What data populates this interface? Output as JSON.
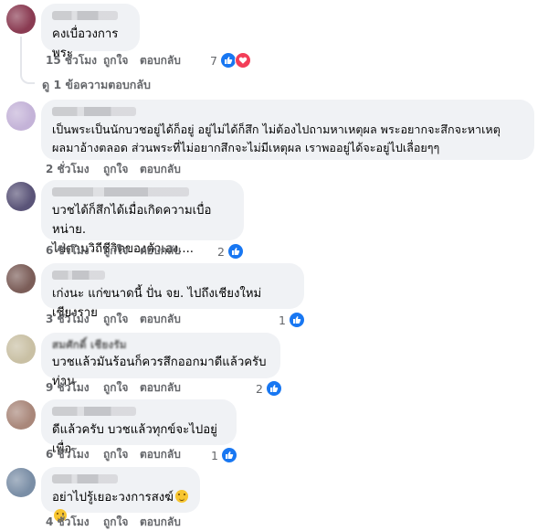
{
  "actions": {
    "like": "ถูกใจ",
    "reply": "ตอบกลับ"
  },
  "view_replies": "ดู 1 ข้อความตอบกลับ",
  "comments": [
    {
      "text": "คงเบื่อวงการพระ",
      "time": "15 ชั่วโมง",
      "reactions": "7",
      "reaction_icons": [
        "like-icon",
        "heart-icon"
      ]
    },
    {
      "text": "เป็นพระเป็นนักบวชอยู่ได้ก็อยู่ อยู่ไม่ได้ก็สึก ไม่ต้องไปถามหาเหตุผล พระอยากจะสึกจะหาเหตุ\nผลมาอ้างตลอด ส่วนพระที่ไม่อยากสึกจะไม่มีเหตุผล เราพออยู่ได้จะอยู่ไปเลื่อยๆๆ",
      "time": "2 ชั่วโมง",
      "reactions": ""
    },
    {
      "text": "บวชได้ก็สึกได้เมื่อเกิดความเบื่อหน่าย.\nไปตามวิถีชีวิตของตัวเอง....",
      "time": "6 ชั่วโมง",
      "reactions": "2"
    },
    {
      "text": "เก่งนะ แก่ขนาดนี้ ปั่น จย. ไปถึงเชียงใหม่ เชียงราย",
      "time": "3 ชั่วโมง",
      "reactions": "1"
    },
    {
      "name": "สมศักดิ์ เชียงรัม",
      "text": "บวชแล้วมันร้อนก็ควรสึกออกมาดีแล้วครับท่าน",
      "time": "9 ชั่วโมง",
      "reactions": "2"
    },
    {
      "text": "ดีแล้วครับ บวชแล้วทุกข์จะไปอยู่เพื่อ",
      "time": "6 ชั่วโมง",
      "reactions": "1"
    },
    {
      "text": "อย่าไปรู้เยอะวงการสงฆ์",
      "time": "4 ชั่วโมง",
      "reactions": ""
    }
  ],
  "colors": {
    "bubble": "#f0f2f5",
    "meta": "#65676b",
    "like": "#1877f2",
    "love": "#f33e58"
  }
}
